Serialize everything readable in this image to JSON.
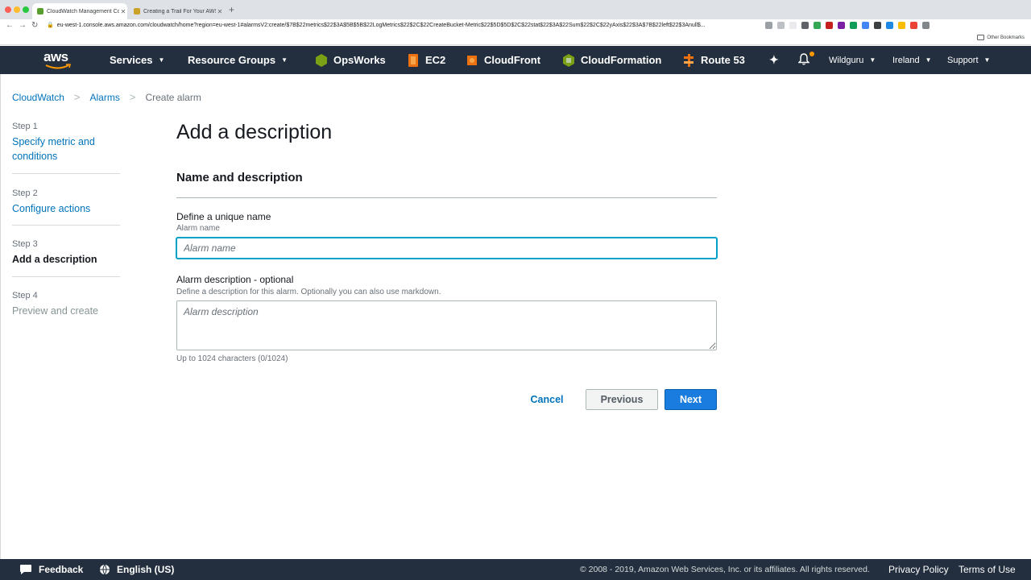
{
  "browser": {
    "tabs": [
      {
        "title": "CloudWatch Management Con",
        "active": true,
        "favicon_color": "#5a9e2f"
      },
      {
        "title": "Creating a Trail For Your AWS",
        "active": false,
        "favicon_color": "#c9a227"
      }
    ],
    "url": "eu-west-1.console.aws.amazon.com/cloudwatch/home?region=eu-west-1#alarmsV2:create/$7B$22metrics$22$3A$5B$5B$22LogMetrics$22$2C$22CreateBucket-Metric$22$5D$5D$2C$22stat$22$3A$22Sum$22$2C$22yAxis$22$3A$7B$22left$22$3Anull$...",
    "other_bookmarks": "Other Bookmarks"
  },
  "header": {
    "services": "Services",
    "resource_groups": "Resource Groups",
    "shortcuts": [
      {
        "label": "OpsWorks",
        "color": "#7aa116"
      },
      {
        "label": "EC2",
        "color": "#ec7211"
      },
      {
        "label": "CloudFront",
        "color": "#ec7211"
      },
      {
        "label": "CloudFormation",
        "color": "#7aa116"
      },
      {
        "label": "Route 53",
        "color": "#ec7211"
      }
    ],
    "user": "Wildguru",
    "region": "Ireland",
    "support": "Support"
  },
  "breadcrumb": {
    "items": [
      "CloudWatch",
      "Alarms",
      "Create alarm"
    ]
  },
  "steps": [
    {
      "num": "Step 1",
      "label": "Specify metric and conditions"
    },
    {
      "num": "Step 2",
      "label": "Configure actions"
    },
    {
      "num": "Step 3",
      "label": "Add a description"
    },
    {
      "num": "Step 4",
      "label": "Preview and create"
    }
  ],
  "form": {
    "title": "Add a description",
    "section": "Name and description",
    "name_heading": "Define a unique name",
    "name_label": "Alarm name",
    "name_placeholder": "Alarm name",
    "desc_heading": "Alarm description - optional",
    "desc_hint": "Define a description for this alarm. Optionally you can also use markdown.",
    "desc_placeholder": "Alarm description",
    "char_count": "Up to 1024 characters (0/1024)"
  },
  "buttons": {
    "cancel": "Cancel",
    "previous": "Previous",
    "next": "Next"
  },
  "footer": {
    "feedback": "Feedback",
    "language": "English (US)",
    "copyright": "© 2008 - 2019, Amazon Web Services, Inc. or its affiliates. All rights reserved.",
    "privacy": "Privacy Policy",
    "terms": "Terms of Use"
  }
}
